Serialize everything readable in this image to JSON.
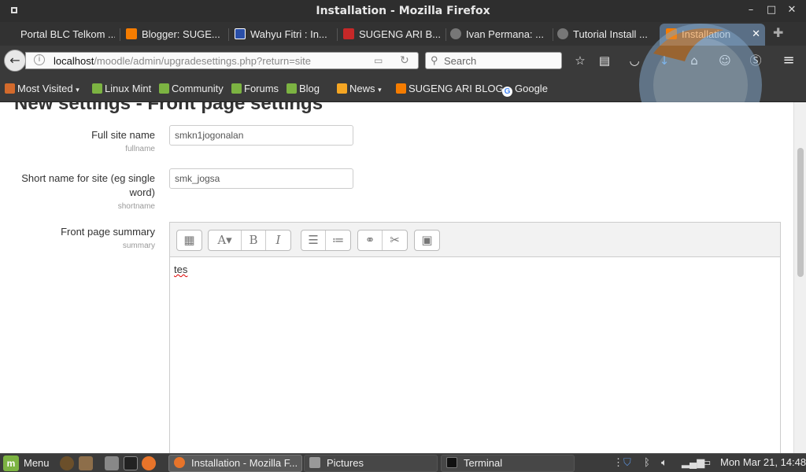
{
  "window": {
    "title": "Installation - Mozilla Firefox"
  },
  "tabs": [
    {
      "label": "Portal BLC Telkom ..."
    },
    {
      "label": "Blogger: SUGE..."
    },
    {
      "label": "Wahyu Fitri : In..."
    },
    {
      "label": "SUGENG ARI B..."
    },
    {
      "label": "Ivan Permana: ..."
    },
    {
      "label": "Tutorial Install ..."
    },
    {
      "label": "Installation"
    }
  ],
  "navbar": {
    "url_host": "localhost",
    "url_path": "/moodle/admin/upgradesettings.php?return=site",
    "search_placeholder": "Search"
  },
  "bookmarks": [
    {
      "label": "Most Visited"
    },
    {
      "label": "Linux Mint"
    },
    {
      "label": "Community"
    },
    {
      "label": "Forums"
    },
    {
      "label": "Blog"
    },
    {
      "label": "News"
    },
    {
      "label": "SUGENG ARI BLOG"
    },
    {
      "label": "Google"
    }
  ],
  "page": {
    "title": "New settings - Front page settings",
    "fields": [
      {
        "label": "Full site name",
        "sub": "fullname",
        "value": "smkn1jogonalan"
      },
      {
        "label": "Short name for site (eg single word)",
        "sub": "shortname",
        "value": "smk_jogsa"
      },
      {
        "label": "Front page summary",
        "sub": "summary",
        "value": "tes"
      }
    ]
  },
  "taskbar": {
    "menu_label": "Menu",
    "windows": [
      {
        "label": "Installation - Mozilla F..."
      },
      {
        "label": "Pictures"
      },
      {
        "label": "Terminal"
      }
    ],
    "clock": "Mon Mar 21, 14:48"
  },
  "colors": {
    "blogger": "#f57c00",
    "mint": "#7cb342",
    "active_tab": "#5a6f86"
  }
}
